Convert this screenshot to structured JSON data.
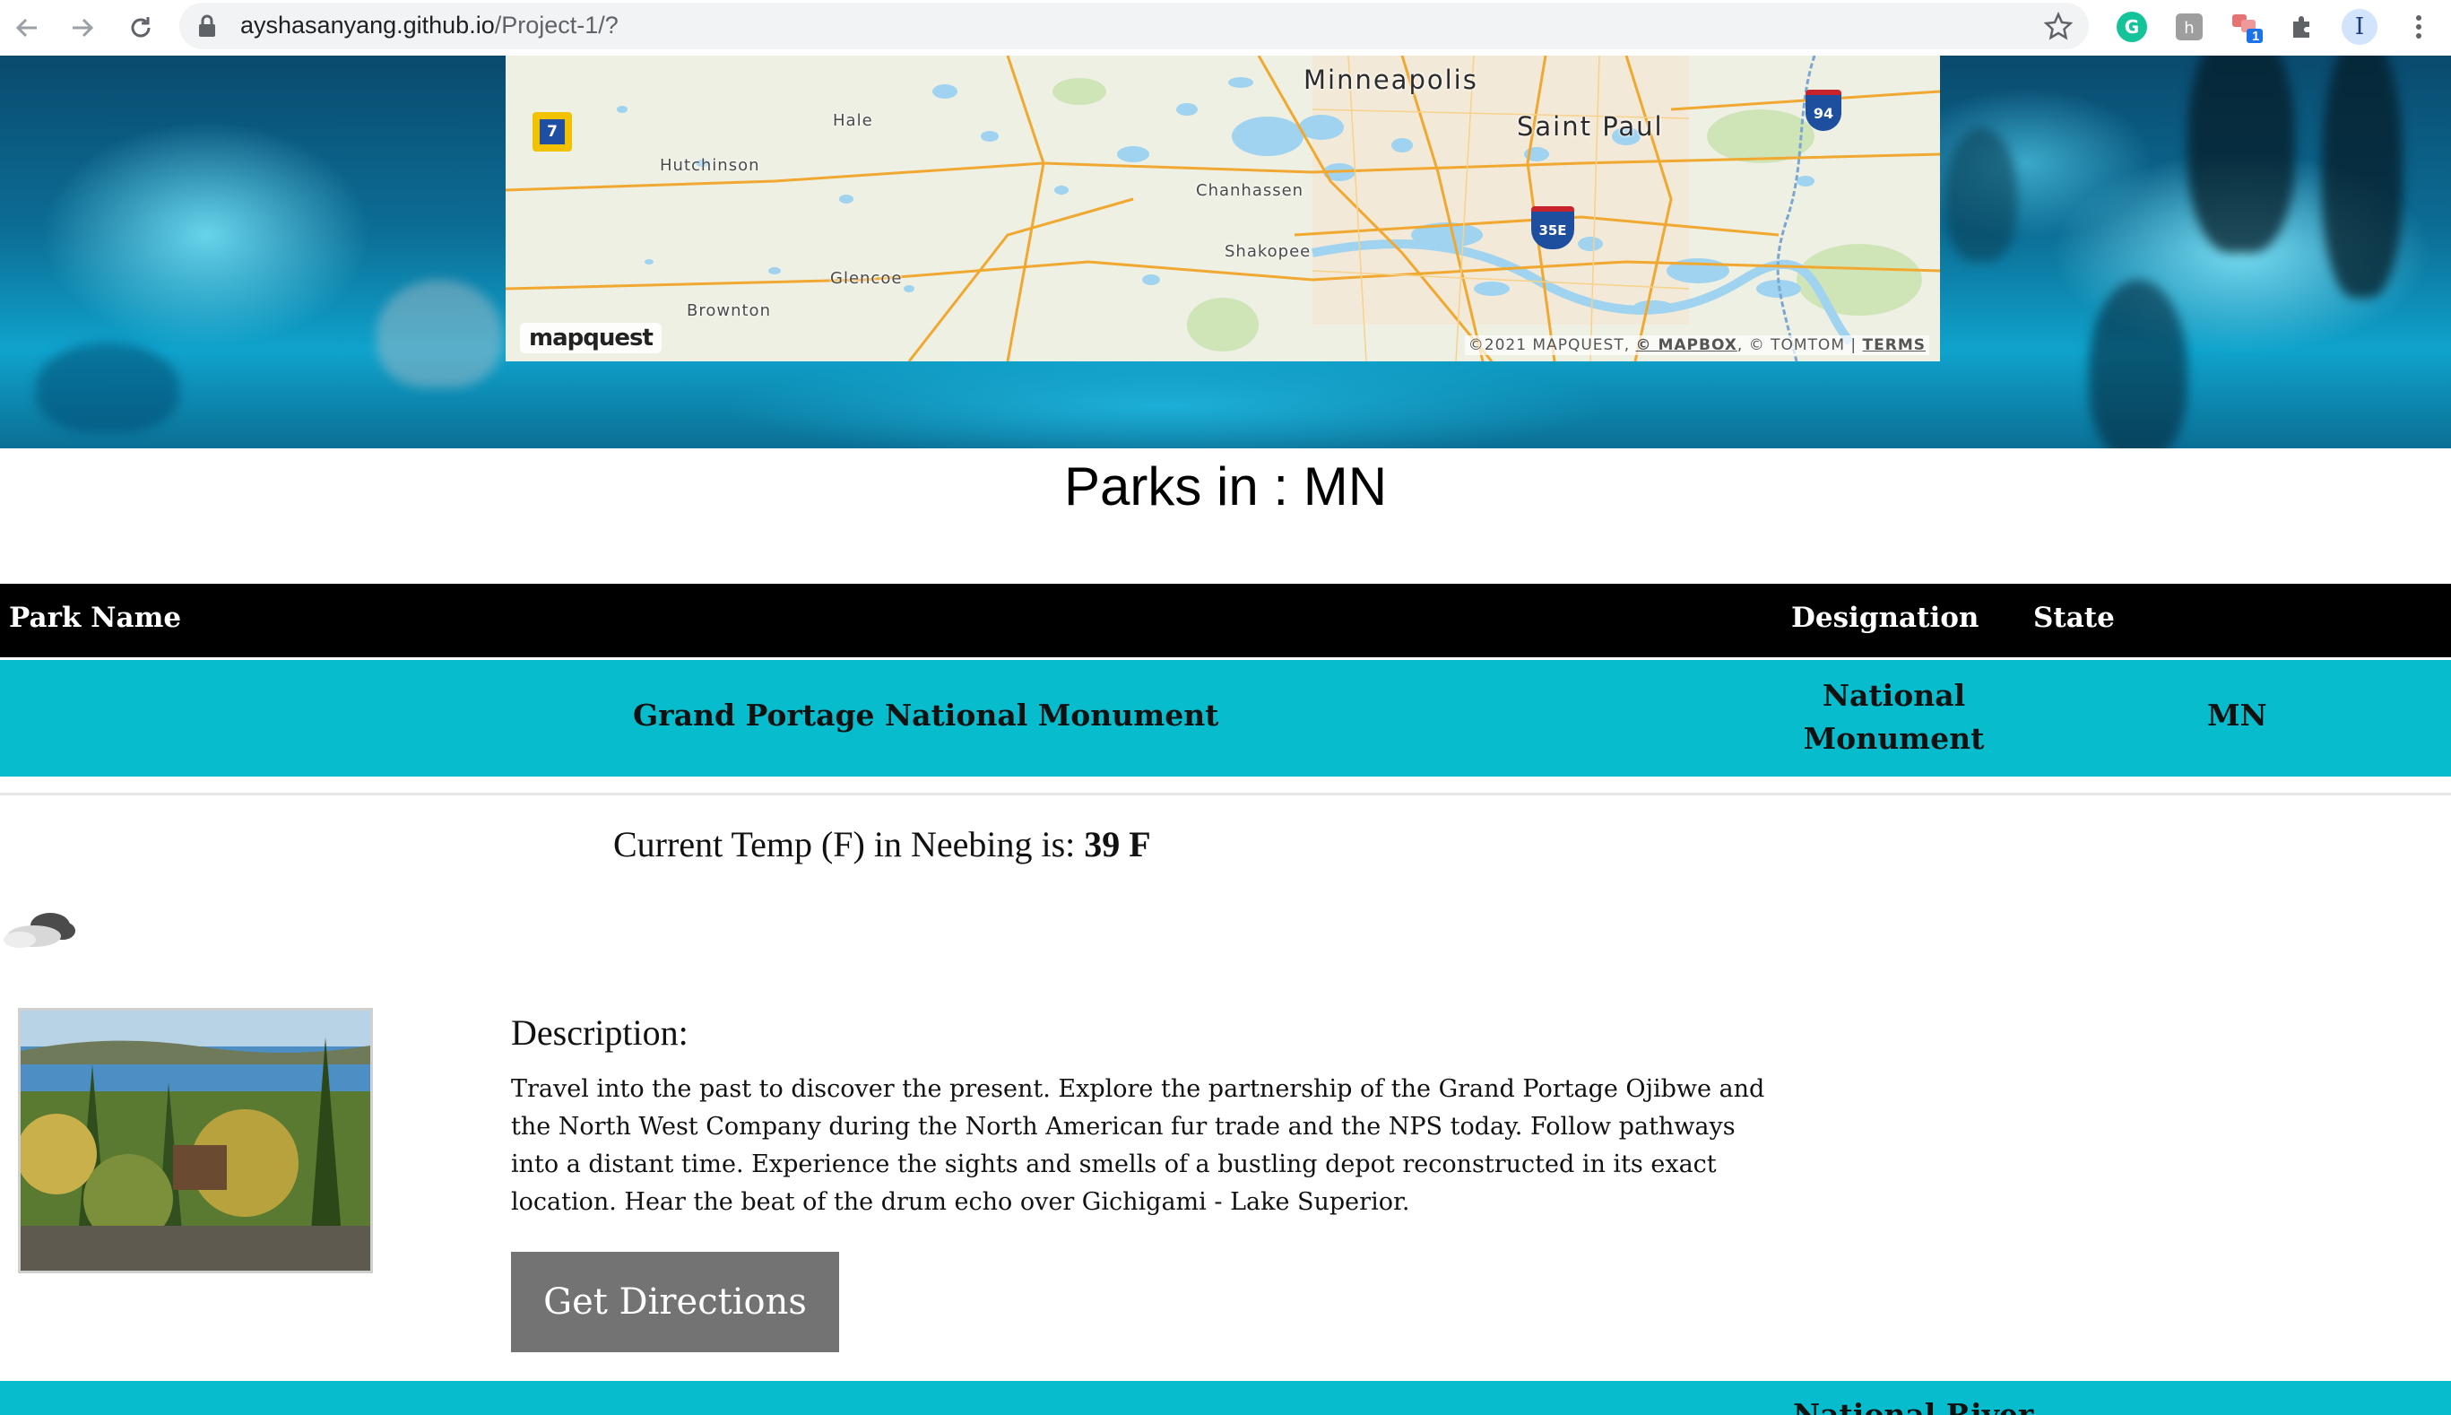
{
  "browser": {
    "url_domain": "ayshasanyang.github.io",
    "url_path": "/Project-1/?",
    "extension_badge": "1",
    "profile_initial": "I"
  },
  "map": {
    "labels": {
      "minneapolis": "Minneapolis",
      "saint_paul": "Saint Paul",
      "hale": "Hale",
      "hutchinson": "Hutchinson",
      "chanhassen": "Chanhassen",
      "shakopee": "Shakopee",
      "glencoe": "Glencoe",
      "brownton": "Brownton"
    },
    "shields": {
      "route_7": "7",
      "i94": "94",
      "i35e": "35E"
    },
    "logo": "mapquest",
    "attribution": {
      "prefix": "©2021 MAPQUEST, ",
      "mapbox": "© MAPBOX",
      "mid": ", © TOMTOM | ",
      "terms": "TERMS"
    }
  },
  "page": {
    "title": "Parks in : MN"
  },
  "table": {
    "headers": {
      "park_name": "Park Name",
      "designation": "Designation",
      "state": "State"
    },
    "rows": [
      {
        "name": "Grand Portage National Monument",
        "designation_line1": "National",
        "designation_line2": "Monument",
        "state": "MN"
      }
    ],
    "next_row_partial": "National River"
  },
  "weather": {
    "label": "Current Temp (F) in Neebing is: ",
    "value": "39 F",
    "icon": "cloudy-icon"
  },
  "description": {
    "title": "Description:",
    "text": "Travel into the past to discover the present. Explore the partnership of the Grand Portage Ojibwe and the North West Company during the North American fur trade and the NPS today. Follow pathways into a distant time. Experience the sights and smells of a bustling depot reconstructed in its exact location. Hear the beat of the drum echo over Gichigami - Lake Superior."
  },
  "buttons": {
    "directions": "Get Directions"
  },
  "colors": {
    "teal": "#07bccc",
    "header_black": "#000000",
    "button_gray": "#737373"
  }
}
